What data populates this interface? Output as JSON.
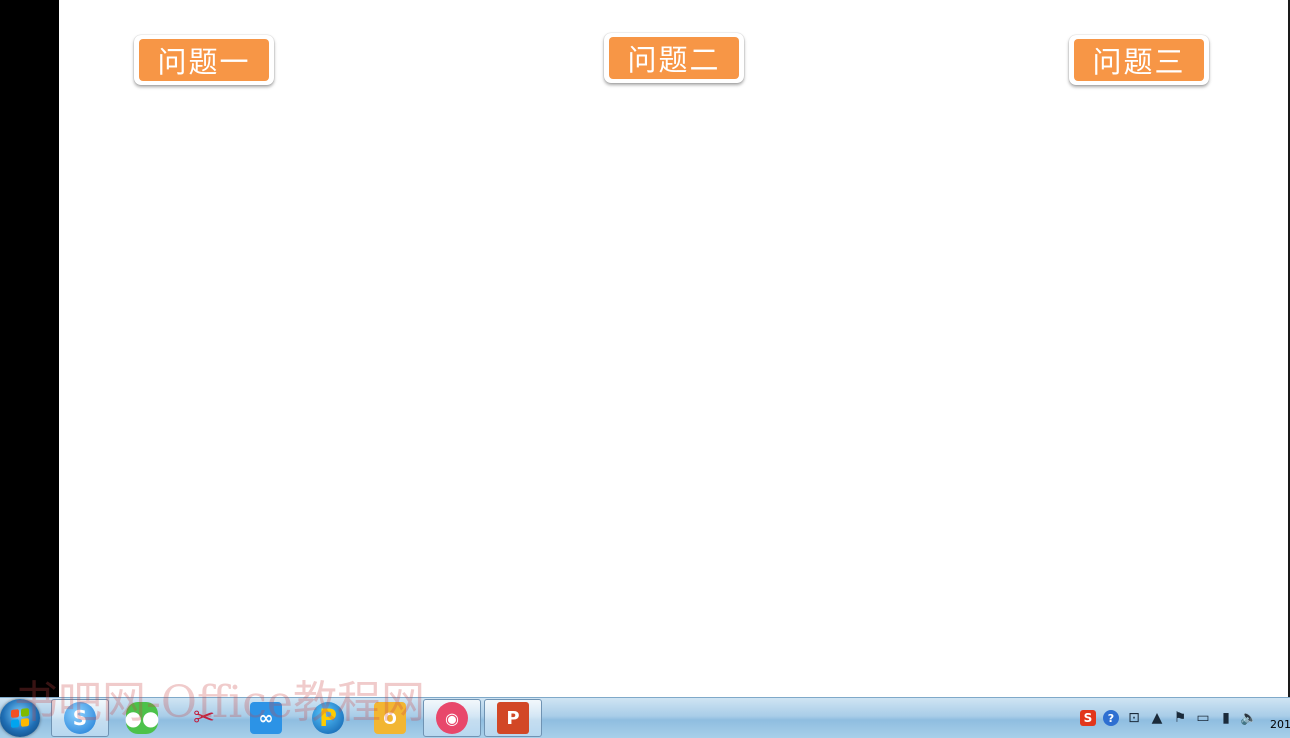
{
  "slide": {
    "buttons": [
      {
        "label": "问题一"
      },
      {
        "label": "问题二"
      },
      {
        "label": "问题三"
      }
    ],
    "button_color": "#f79646"
  },
  "watermark": {
    "text": "书吧网-Office教程网"
  },
  "taskbar": {
    "items": [
      {
        "icon": "sogou-browser-icon",
        "glyph": "S"
      },
      {
        "icon": "wechat-icon",
        "glyph": "●●"
      },
      {
        "icon": "scissors-icon",
        "glyph": "✂"
      },
      {
        "icon": "baidu-netdisk-icon",
        "glyph": "∞"
      },
      {
        "icon": "pptv-icon",
        "glyph": "P"
      },
      {
        "icon": "outlook-icon",
        "glyph": "O"
      },
      {
        "icon": "camera-icon",
        "glyph": "◉"
      },
      {
        "icon": "powerpoint-icon",
        "glyph": "P"
      }
    ],
    "tray": {
      "ime": "S",
      "help": "?",
      "clock": "201"
    }
  }
}
